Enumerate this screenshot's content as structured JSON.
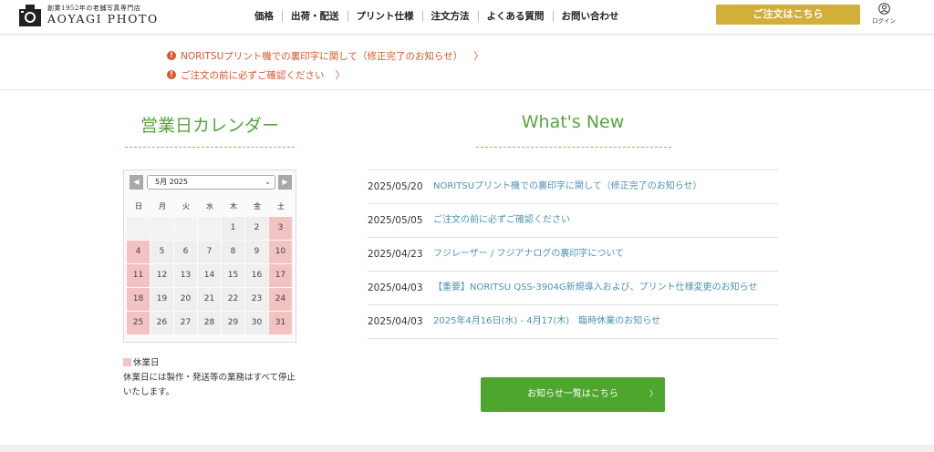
{
  "header": {
    "logo_tagline": "創業1952年の老舗写真専門店",
    "logo_name": "AOYAGI PHOTO",
    "nav": [
      "価格",
      "出荷・配送",
      "プリント仕様",
      "注文方法",
      "よくある質問",
      "お問い合わせ"
    ],
    "order_button": "ご注文はこちら",
    "login_label": "ログイン"
  },
  "notices": [
    {
      "text": "NORITSUプリント機での裏印字に関して（修正完了のお知らせ）",
      "chev": "〉"
    },
    {
      "text": "ご注文の前に必ずご確認ください",
      "chev": "〉"
    }
  ],
  "calendar": {
    "title": "営業日カレンダー",
    "month_select": "5月 2025",
    "prev": "◀",
    "next": "▶",
    "weekdays": [
      "日",
      "月",
      "火",
      "水",
      "木",
      "金",
      "土"
    ],
    "weeks": [
      [
        "",
        "",
        "",
        "",
        "1",
        "2",
        "3"
      ],
      [
        "4",
        "5",
        "6",
        "7",
        "8",
        "9",
        "10"
      ],
      [
        "11",
        "12",
        "13",
        "14",
        "15",
        "16",
        "17"
      ],
      [
        "18",
        "19",
        "20",
        "21",
        "22",
        "23",
        "24"
      ],
      [
        "25",
        "26",
        "27",
        "28",
        "29",
        "30",
        "31"
      ]
    ],
    "holidays": [
      "3",
      "4",
      "10",
      "11",
      "17",
      "18",
      "24",
      "25",
      "31"
    ],
    "legend_label": "休業日",
    "legend_note": "休業日には製作・発送等の業務はすべて停止いたします。"
  },
  "news": {
    "title": "What's New",
    "items": [
      {
        "date": "2025/05/20",
        "title": "NORITSUプリント機での裏印字に関して（修正完了のお知らせ）"
      },
      {
        "date": "2025/05/05",
        "title": "ご注文の前に必ずご確認ください"
      },
      {
        "date": "2025/04/23",
        "title": "フジレーザー / フジアナログの裏印字について"
      },
      {
        "date": "2025/04/03",
        "title": "【重要】NORITSU QSS-3904G新規導入および、プリント仕様変更のお知らせ"
      },
      {
        "date": "2025/04/03",
        "title": "2025年4月16日(水) - 4月17(木)　臨時休業のお知らせ"
      }
    ],
    "more_button": "お知らせ一覧はこちら",
    "more_chev": "〉"
  },
  "colors": {
    "accent_green": "#4ea62f",
    "title_green": "#56a53c",
    "gold": "#d2ae3a",
    "alert_orange": "#d8572d",
    "link_blue": "#4d93b0",
    "holiday_pink": "#f3c2c2"
  }
}
